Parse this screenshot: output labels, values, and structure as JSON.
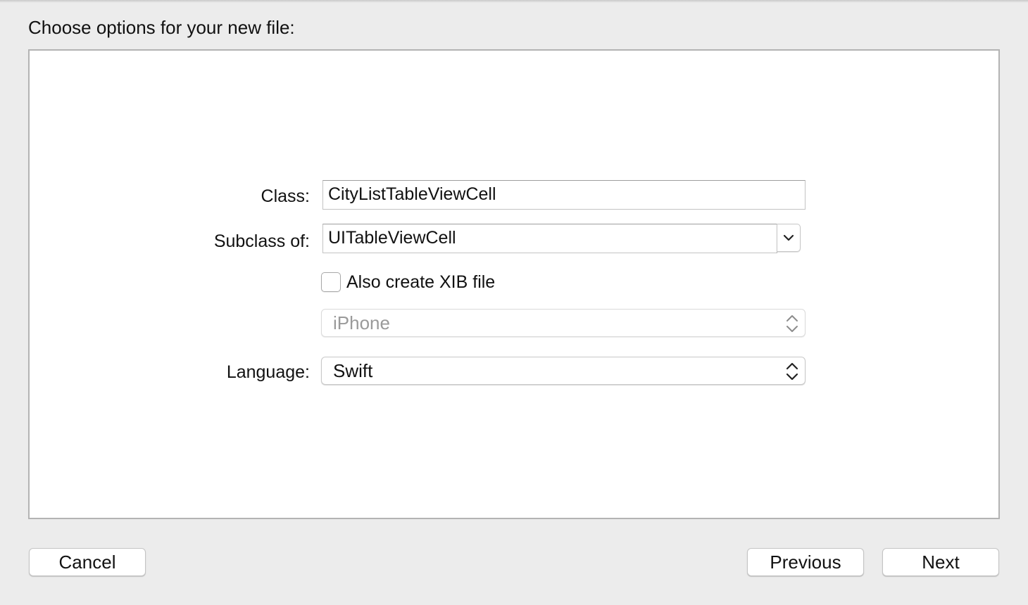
{
  "dialog": {
    "heading": "Choose options for your new file:"
  },
  "form": {
    "class_label": "Class:",
    "class_value": "CityListTableViewCell",
    "subclass_label": "Subclass of:",
    "subclass_value": "UITableViewCell",
    "xib_checkbox_label": "Also create XIB file",
    "xib_checked": false,
    "device_value": "iPhone",
    "device_enabled": false,
    "language_label": "Language:",
    "language_value": "Swift"
  },
  "footer": {
    "cancel_label": "Cancel",
    "previous_label": "Previous",
    "next_label": "Next"
  },
  "icons": {
    "combo": "chevron-down-icon",
    "popup": "up-down-stepper-icon"
  }
}
